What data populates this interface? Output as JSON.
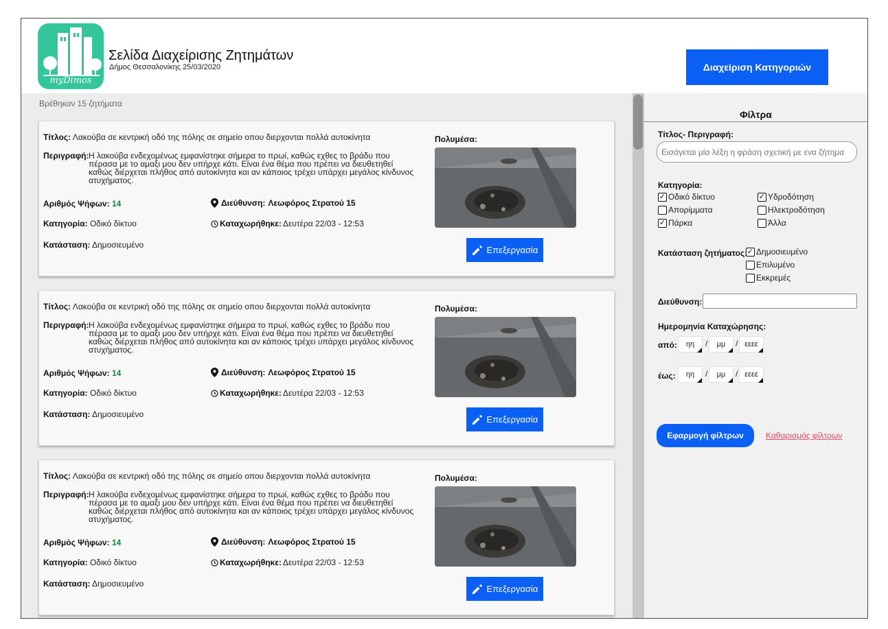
{
  "header": {
    "logo_text": "myDimos",
    "title": "Σελίδα Διαχείρισης Ζητημάτων",
    "subtitle": "Δήμος Θεσσαλονίκης 25/03/2020",
    "categories_button": "Διαχείριση Κατηγοριών"
  },
  "list": {
    "found_count": "Βρέθηκαν 15 ζητήματα",
    "issues": [
      {
        "title_label": "Τίτλος:",
        "title": "Λακούβα σε κεντρική οδό της πόλης σε σημείο οπου διερχονται πολλά αυτοκίνητα",
        "description_label": "Περιγραφή:",
        "description": "Η λακούβα ενδεχομένως εμφανίστηκε σήμερα το πρωί, καθώς εχθες το βράδυ που πέρασα με το αμαξι μου δεν υπήρχε κάτι. Είναι ένα θέμα που πρέπει να διευθετηθεί καθώς διέρχεται πλήθος από αυτοκίνητα και αν κάποιος τρέχει υπάρχει μεγάλος κίνδυνος ατυχήματος.",
        "votes_label": "Αριθμός Ψήφων:",
        "votes": "14",
        "address_label": "Διεύθυνση:",
        "address": "Λεωφόρος Στρατού 15",
        "category_label": "Κατηγορία:",
        "category": "Οδικό δίκτυο",
        "registered_label": "Καταχωρήθηκε:",
        "registered": "Δευτέρα 22/03 - 12:53",
        "status_label": "Κατάσταση:",
        "status": "Δημοσιευμένο",
        "media_label": "Πολυμέσα:",
        "edit_label": "Επεξεργασία"
      },
      {
        "title_label": "Τίτλος:",
        "title": "Λακούβα σε κεντρική οδό της πόλης σε σημείο οπου διερχονται πολλά αυτοκίνητα",
        "description_label": "Περιγραφή:",
        "description": "Η λακούβα ενδεχομένως εμφανίστηκε σήμερα το πρωί, καθώς εχθες το βράδυ που πέρασα με το αμαξι μου δεν υπήρχε κάτι. Είναι ένα θέμα που πρέπει να διευθετηθεί καθώς διέρχεται πλήθος από αυτοκίνητα και αν κάποιος τρέχει υπάρχει μεγάλος κίνδυνος ατυχήματος.",
        "votes_label": "Αριθμός Ψήφων:",
        "votes": "14",
        "address_label": "Διεύθυνση:",
        "address": "Λεωφόρος Στρατού 15",
        "category_label": "Κατηγορία:",
        "category": "Οδικό δίκτυο",
        "registered_label": "Καταχωρήθηκε:",
        "registered": "Δευτέρα 22/03 - 12:53",
        "status_label": "Κατάσταση:",
        "status": "Δημοσιευμένο",
        "media_label": "Πολυμέσα:",
        "edit_label": "Επεξεργασία"
      },
      {
        "title_label": "Τίτλος:",
        "title": "Λακούβα σε κεντρική οδό της πόλης σε σημείο οπου διερχονται πολλά αυτοκίνητα",
        "description_label": "Περιγραφή:",
        "description": "Η λακούβα ενδεχομένως εμφανίστηκε σήμερα το πρωί, καθώς εχθες το βράδυ που πέρασα με το αμαξι μου δεν υπήρχε κάτι. Είναι ένα θέμα που πρέπει να διευθετηθεί καθώς διέρχεται πλήθος από αυτοκίνητα και αν κάποιος τρέχει υπάρχει μεγάλος κίνδυνος ατυχήματος.",
        "votes_label": "Αριθμός Ψήφων:",
        "votes": "14",
        "address_label": "Διεύθυνση:",
        "address": "Λεωφόρος Στρατού 15",
        "category_label": "Κατηγορία:",
        "category": "Οδικό δίκτυο",
        "registered_label": "Καταχωρήθηκε:",
        "registered": "Δευτέρα 22/03 - 12:53",
        "status_label": "Κατάσταση:",
        "status": "Δημοσιευμένο",
        "media_label": "Πολυμέσα:",
        "edit_label": "Επεξεργασία"
      }
    ]
  },
  "filters": {
    "title": "Φίλτρα",
    "search_label": "Τίτλος- Περιγραφή:",
    "search_placeholder": "Εισάγεται μία λέξη η φράση σχετική με ενα ζήτημα",
    "category_label": "Κατηγορία:",
    "categories": [
      {
        "label": "Οδικό δίκτυο",
        "checked": true
      },
      {
        "label": "Υδροδότηση",
        "checked": true
      },
      {
        "label": "Απορίμματα",
        "checked": false
      },
      {
        "label": "Ηλεκτροδότηση",
        "checked": false
      },
      {
        "label": "Πάρκα",
        "checked": true
      },
      {
        "label": "Άλλα",
        "checked": false
      }
    ],
    "status_label": "Κατάσταση ζητήματος:",
    "statuses": [
      {
        "label": "Δημοσιευμένο",
        "checked": true
      },
      {
        "label": "Επιλυμένο",
        "checked": false
      },
      {
        "label": "Εκκρεμές",
        "checked": false
      }
    ],
    "address_label": "Διεύθυνση:",
    "date_label": "Ημερομηνία Καταχώρησης:",
    "from_label": "από:",
    "to_label": "έως:",
    "day_placeholder": "ηη",
    "month_placeholder": "μμ",
    "year_placeholder": "εεεε",
    "date_separator": "/",
    "apply_button": "Εφαρμογή φίλτρων",
    "clear_link": "Καθαρισμός φίλτρων"
  },
  "colors": {
    "accent": "#0a5ff5",
    "logo": "#33c69b",
    "votes": "#1b7f3d",
    "clear_link": "#e2495f"
  },
  "icons": [
    "location-pin-icon",
    "clock-icon",
    "pencil-icon",
    "checkmark-icon"
  ]
}
